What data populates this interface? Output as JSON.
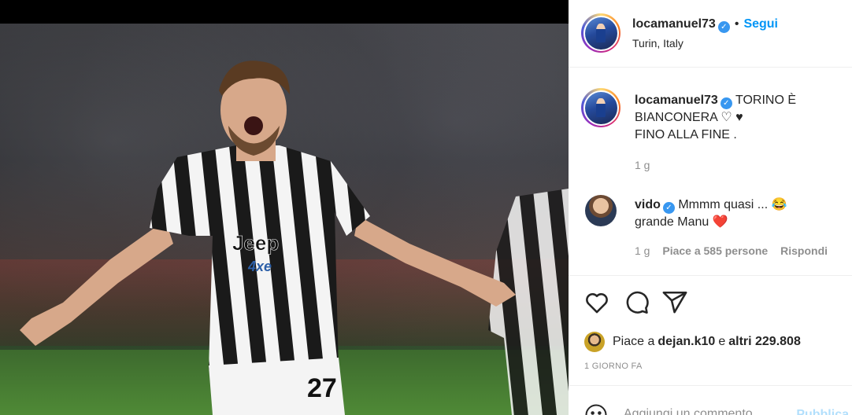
{
  "post": {
    "username": "locamanuel73",
    "verified": true,
    "location": "Turin, Italy",
    "follow_label": "Segui",
    "separator": "•"
  },
  "caption": {
    "username": "locamanuel73",
    "line1": "TORINO È",
    "line2": "BIANCONERA ♡ ♥",
    "line3": "FINO ALLA FINE .",
    "time": "1 g"
  },
  "comment": {
    "username": "vido",
    "line1": "Mmmm quasi ... 😂",
    "line2": "grande Manu ❤️",
    "time": "1 g",
    "likes": "Piace a 585 persone",
    "reply": "Rispondi"
  },
  "actions": {
    "icons": [
      "heart-icon",
      "comment-icon",
      "share-icon"
    ]
  },
  "likes": {
    "prefix": "Piace a",
    "user": "dejan.k10",
    "conj": "e",
    "others": "altri 229.808"
  },
  "timestamp": "1 GIORNO FA",
  "add_comment": {
    "placeholder": "Aggiungi un commento...",
    "post_label": "Pubblica"
  },
  "photo": {
    "jersey_sponsor": "Jeep",
    "jersey_sub": "4xe",
    "jersey_number": "27"
  }
}
